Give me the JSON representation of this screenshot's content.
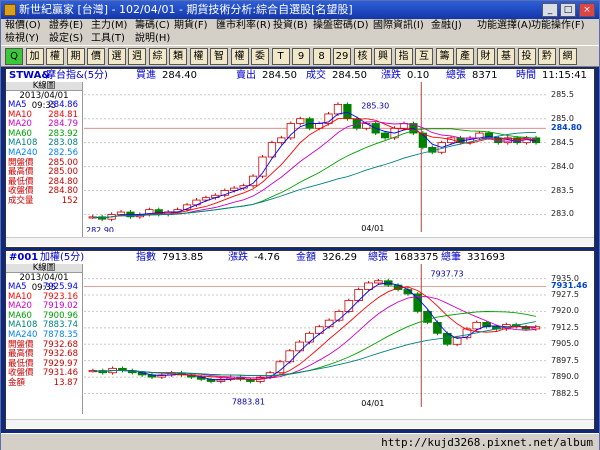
{
  "window": {
    "title": "新世紀贏家 [台灣] - 102/04/01 - 期貨技術分析:綜合自選股[名望股]",
    "buttons": [
      "_",
      "□",
      "×"
    ]
  },
  "menu": {
    "row1": [
      "報價(O)",
      "證券(E)",
      "主力(M)",
      "籌碼(C)",
      "期貨(F)",
      "匯市利率(R)",
      "投資(B)",
      "操盤密碼(D)",
      "國際資訊(I)",
      "金融(J)",
      "功能選擇(A)",
      "功能操作(F)"
    ],
    "row2": [
      "檢視(Y)",
      "設定(S)",
      "工具(T)",
      "說明(H)"
    ]
  },
  "toolbar": {
    "buttons": [
      "Q",
      "加",
      "權",
      "期",
      "價",
      "選",
      "週",
      "綜",
      "類",
      "權",
      "智",
      "權",
      "委",
      "T",
      "9",
      "8",
      "29",
      "核",
      "興",
      "指",
      "互",
      "籌",
      "產",
      "財",
      "基",
      "投",
      "黔",
      "網"
    ]
  },
  "chart_data": [
    {
      "type": "candlestick",
      "header": {
        "symbol": "STWA&",
        "name": "摩台指&(5分)",
        "fields": [
          {
            "label": "買進",
            "value": "284.40"
          },
          {
            "label": "賣出",
            "value": "284.50"
          },
          {
            "label": "成交",
            "value": "284.50"
          },
          {
            "label": "漲跌",
            "value": "0.10"
          },
          {
            "label": "總張",
            "value": "8371"
          },
          {
            "label": "時間",
            "value": "11:15:41"
          }
        ]
      },
      "info": {
        "title": "K線圖",
        "datetime": "2013/04/01 09:35",
        "rows": [
          {
            "label": "MA5",
            "value": "284.86",
            "color": "#0000ff"
          },
          {
            "label": "MA10",
            "value": "284.81",
            "color": "#ff0000"
          },
          {
            "label": "MA20",
            "value": "284.79",
            "color": "#cc00cc"
          },
          {
            "label": "MA60",
            "value": "283.92",
            "color": "#00a000"
          },
          {
            "label": "MA108",
            "value": "283.08",
            "color": "#008080"
          },
          {
            "label": "MA240",
            "value": "282.56",
            "color": "#0080ff"
          },
          {
            "label": "開盤價",
            "value": "285.00",
            "color": "#cc0000"
          },
          {
            "label": "最高價",
            "value": "285.00",
            "color": "#cc0000"
          },
          {
            "label": "最低價",
            "value": "284.80",
            "color": "#cc0000"
          },
          {
            "label": "收盤價",
            "value": "284.80",
            "color": "#cc0000"
          },
          {
            "label": "成交量",
            "value": "152",
            "color": "#cc0000"
          }
        ]
      },
      "y_ticks": [
        "285.5",
        "285.0",
        "284.5",
        "284.0",
        "283.5",
        "283.0"
      ],
      "ylim": [
        282.8,
        285.6
      ],
      "current_price_label": "284.80",
      "x_label": "04/01",
      "annotations": [
        {
          "text": "285.30"
        },
        {
          "text": "282.90"
        }
      ],
      "close_series": [
        282.95,
        282.9,
        283.0,
        283.05,
        282.95,
        283.0,
        283.1,
        283.0,
        283.05,
        283.1,
        283.2,
        283.3,
        283.35,
        283.4,
        283.5,
        283.55,
        283.6,
        283.8,
        284.2,
        284.5,
        284.6,
        284.9,
        285.0,
        284.8,
        284.9,
        285.1,
        285.3,
        285.0,
        284.8,
        284.9,
        284.7,
        284.6,
        284.8,
        284.9,
        284.7,
        284.4,
        284.3,
        284.5,
        284.6,
        284.5,
        284.6,
        284.7,
        284.6,
        284.5,
        284.6,
        284.5,
        284.6,
        284.5
      ]
    },
    {
      "type": "candlestick",
      "header": {
        "symbol": "#001",
        "name": "加權(5分)",
        "fields": [
          {
            "label": "指數",
            "value": "7913.85"
          },
          {
            "label": "漲跌",
            "value": "-4.76"
          },
          {
            "label": "金額",
            "value": "326.29"
          },
          {
            "label": "總張",
            "value": "1683375"
          },
          {
            "label": "總筆",
            "value": "331693"
          }
        ]
      },
      "info": {
        "title": "K線圖",
        "datetime": "2013/04/01 09:35",
        "rows": [
          {
            "label": "MA5",
            "value": "7925.94",
            "color": "#0000ff"
          },
          {
            "label": "MA10",
            "value": "7923.16",
            "color": "#ff0000"
          },
          {
            "label": "MA20",
            "value": "7919.02",
            "color": "#cc00cc"
          },
          {
            "label": "MA60",
            "value": "7900.96",
            "color": "#00a000"
          },
          {
            "label": "MA108",
            "value": "7883.74",
            "color": "#008080"
          },
          {
            "label": "MA240",
            "value": "7878.35",
            "color": "#0080ff"
          },
          {
            "label": "開盤價",
            "value": "7932.68",
            "color": "#cc0000"
          },
          {
            "label": "最高價",
            "value": "7932.68",
            "color": "#cc0000"
          },
          {
            "label": "最低價",
            "value": "7929.97",
            "color": "#cc0000"
          },
          {
            "label": "收盤價",
            "value": "7931.46",
            "color": "#cc0000"
          },
          {
            "label": "金額",
            "value": "13.87",
            "color": "#cc0000"
          }
        ]
      },
      "y_ticks": [
        "7935.0",
        "7927.5",
        "7920.0",
        "7912.5",
        "7905.0",
        "7897.5",
        "7890.0",
        "7882.5"
      ],
      "ylim": [
        7880,
        7938
      ],
      "current_price_label": "7931.46",
      "x_label": "04/01",
      "annotations": [
        {
          "text": "7937.73"
        },
        {
          "text": "7883.81"
        }
      ],
      "close_series": [
        7893,
        7892,
        7894,
        7893,
        7892,
        7891,
        7890,
        7891,
        7892,
        7891,
        7890,
        7889,
        7888,
        7889,
        7890,
        7889,
        7888,
        7890,
        7892,
        7897,
        7902,
        7906,
        7910,
        7913,
        7916,
        7920,
        7925,
        7930,
        7933,
        7934,
        7932,
        7930,
        7928,
        7920,
        7915,
        7910,
        7905,
        7908,
        7912,
        7915,
        7913,
        7912,
        7914,
        7913,
        7912,
        7913
      ]
    }
  ],
  "status": {
    "url": "http://kujd3268.pixnet.net/album"
  },
  "colors": {
    "up": "#cc0000",
    "down": "#008000",
    "grid": "#c8c8c8"
  }
}
